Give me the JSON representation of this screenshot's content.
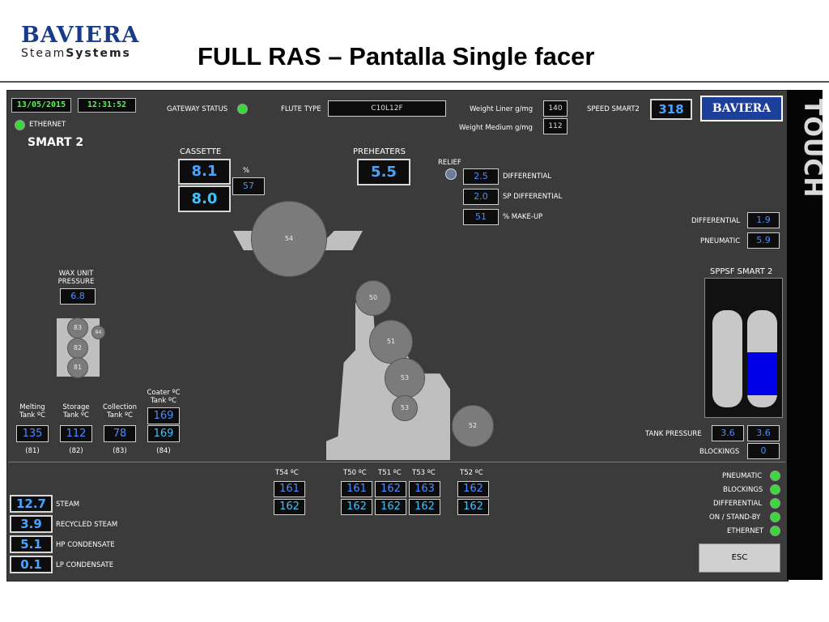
{
  "header": {
    "logo_top": "BAVIERA",
    "logo_bottom_a": "Steam",
    "logo_bottom_b": "Systems",
    "title": "FULL RAS – Pantalla Single facer"
  },
  "topbar": {
    "date": "13/05/2015",
    "time": "12:31:52",
    "ethernet": "ETHERNET",
    "gateway_label": "GATEWAY STATUS",
    "flute_label": "FLUTE TYPE",
    "flute_value": "C10L12F",
    "liner_label": "Weight Liner g/mg",
    "liner_value": "140",
    "medium_label": "Weight Medium g/mg",
    "medium_value": "112",
    "speed_label": "SPEED SMART2",
    "speed_value": "318",
    "brand_button": "BAVIERA",
    "touch": "TOUCH"
  },
  "screen_title": "SMART 2",
  "cassette": {
    "label": "CASSETTE",
    "value1": "8.1",
    "value2": "8.0",
    "pct_label": "%",
    "pct_value": "57"
  },
  "preheaters": {
    "label": "PREHEATERS",
    "value": "5.5"
  },
  "relief": {
    "label": "RELIEF",
    "diff_value": "2.5",
    "diff_label": "DIFFERENTIAL",
    "sp_value": "2.0",
    "sp_label": "SP DIFFERENTIAL",
    "makeup_value": "51",
    "makeup_label": "% MAKE-UP"
  },
  "right_top": {
    "diff_label": "DIFFERENTIAL",
    "diff_value": "1.9",
    "pneu_label": "PNEUMATIC",
    "pneu_value": "5.9"
  },
  "sppsf": {
    "title": "SPPSF SMART 2",
    "tank_pressure_label": "TANK PRESSURE",
    "tp1": "3.6",
    "tp2": "3.6",
    "blockings_label": "BLOCKINGS",
    "blockings_value": "0",
    "fill": 0.44
  },
  "wax": {
    "label1": "WAX UNIT",
    "label2": "PRESSURE",
    "value": "6.8"
  },
  "rolls": {
    "r54": "54",
    "r50": "50",
    "r51": "51",
    "r53a": "53",
    "r53b": "53",
    "r52": "52",
    "r83": "83",
    "r84": "84",
    "r82": "82",
    "r81": "81"
  },
  "tanks": [
    {
      "l1": "Melting",
      "l2": "Tank ºC",
      "value": "135",
      "code": "(81)"
    },
    {
      "l1": "Storage",
      "l2": "Tank ºC",
      "value": "112",
      "code": "(82)"
    },
    {
      "l1": "Collection",
      "l2": "Tank ºC",
      "value": "78",
      "code": "(83)"
    }
  ],
  "coater": {
    "l1": "Coater ºC",
    "l2": "Tank ºC",
    "v1": "169",
    "v2": "169",
    "code": "(84)"
  },
  "steam": [
    {
      "value": "12.7",
      "label": "STEAM"
    },
    {
      "value": "3.9",
      "label": "RECYCLED STEAM"
    },
    {
      "value": "5.1",
      "label": "HP CONDENSATE"
    },
    {
      "value": "0.1",
      "label": "LP CONDENSATE"
    }
  ],
  "temps": [
    {
      "label": "T54 ºC",
      "v1": "161",
      "v2": "162"
    },
    {
      "label": "T50 ºC",
      "v1": "161",
      "v2": "162"
    },
    {
      "label": "T51 ºC",
      "v1": "162",
      "v2": "162"
    },
    {
      "label": "T53 ºC",
      "v1": "163",
      "v2": "162"
    },
    {
      "label": "T52 ºC",
      "v1": "162",
      "v2": "162"
    }
  ],
  "status": {
    "pneumatic": "PNEUMATIC",
    "blockings": "BLOCKINGS",
    "differential": "DIFFERENTIAL",
    "standby": "ON / STAND-BY",
    "ethernet": "ETHERNET",
    "esc": "ESC"
  },
  "colors": {
    "panel": "#3b3b3b",
    "value_blue": "#4f8cff",
    "led_green": "#3ad83a",
    "tank_fill": "#0000e6"
  }
}
